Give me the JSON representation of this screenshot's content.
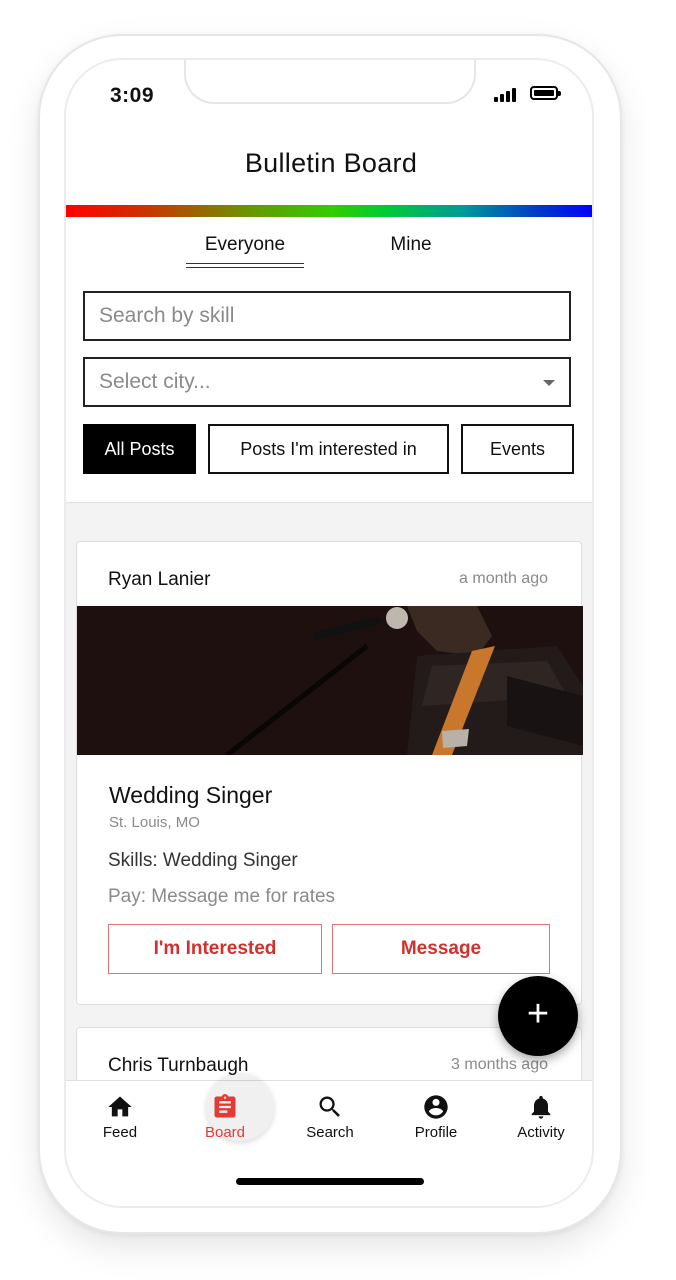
{
  "status_bar": {
    "time": "3:09"
  },
  "header": {
    "title": "Bulletin Board"
  },
  "tabs": [
    {
      "label": "Everyone"
    },
    {
      "label": "Mine"
    }
  ],
  "search": {
    "placeholder": "Search by skill"
  },
  "city_select": {
    "placeholder": "Select city..."
  },
  "filters": [
    {
      "label": "All Posts"
    },
    {
      "label": "Posts I'm interested in"
    },
    {
      "label": "Events"
    }
  ],
  "posts": [
    {
      "author": "Ryan Lanier",
      "time": "a month ago",
      "title": "Wedding Singer",
      "location": "St. Louis, MO",
      "skills": "Skills: Wedding Singer",
      "pay": "Pay: Message me for rates",
      "interested_label": "I'm Interested",
      "message_label": "Message"
    },
    {
      "author": "Chris Turnbaugh",
      "time": "3 months ago"
    }
  ],
  "fab": {
    "label": "+"
  },
  "bottom_nav": [
    {
      "label": "Feed",
      "icon": "home-icon"
    },
    {
      "label": "Board",
      "icon": "clipboard-icon"
    },
    {
      "label": "Search",
      "icon": "search-icon"
    },
    {
      "label": "Profile",
      "icon": "account-circle-icon"
    },
    {
      "label": "Activity",
      "icon": "bell-icon"
    }
  ],
  "colors": {
    "accent": "#e53935",
    "button_text": "#d32f2f",
    "button_border": "#e57373"
  }
}
